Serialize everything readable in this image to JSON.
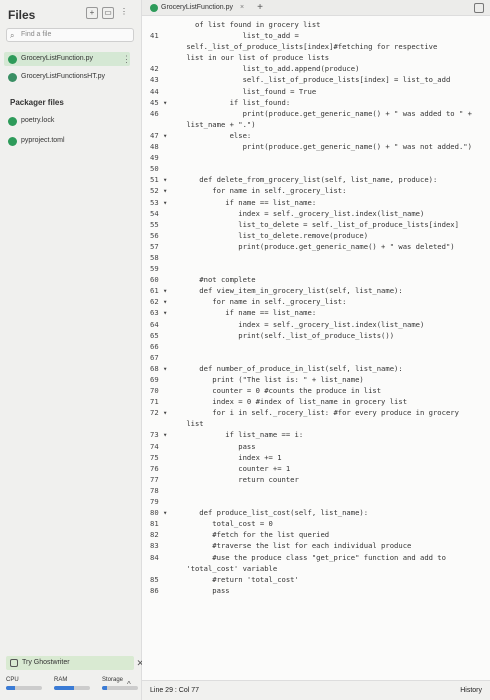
{
  "sidebar": {
    "title": "Files",
    "search_placeholder": "Find a file",
    "files": [
      {
        "name": "GroceryListFunction.py",
        "active": true
      },
      {
        "name": "GroceryListFunctionsHT.py",
        "active": false
      }
    ],
    "packages_label": "Packager files",
    "packages": [
      {
        "name": "poetry.lock"
      },
      {
        "name": "pyproject.toml"
      }
    ],
    "ghostwriter": "Try Ghostwriter",
    "meters": [
      {
        "label": "CPU",
        "level": 0.25
      },
      {
        "label": "RAM",
        "level": 0.55
      },
      {
        "label": "Storage",
        "level": 0.15
      }
    ]
  },
  "editor": {
    "tab_name": "GroceryListFunction.py",
    "tab_close": "×",
    "tab_plus": "+",
    "lines": [
      {
        "n": "",
        "t": "   of list found in grocery list"
      },
      {
        "n": "41",
        "t": "              list_to_add ="
      },
      {
        "n": "",
        "t": " self._list_of_produce_lists[index]#fetching for respective"
      },
      {
        "n": "",
        "t": " list in our list of produce lists"
      },
      {
        "n": "42",
        "t": "              list_to_add.append(produce)"
      },
      {
        "n": "43",
        "t": "              self._list_of_produce_lists[index] = list_to_add"
      },
      {
        "n": "44",
        "t": "              list_found = True"
      },
      {
        "n": "45 ▾",
        "t": "           if list_found:"
      },
      {
        "n": "46",
        "t": "              print(produce.get_generic_name() + \" was added to \" +"
      },
      {
        "n": "",
        "t": " list_name + \".\")"
      },
      {
        "n": "47 ▾",
        "t": "           else:"
      },
      {
        "n": "48",
        "t": "              print(produce.get_generic_name() + \" was not added.\")"
      },
      {
        "n": "49",
        "t": ""
      },
      {
        "n": "50",
        "t": ""
      },
      {
        "n": "51 ▾",
        "t": "    def delete_from_grocery_list(self, list_name, produce):"
      },
      {
        "n": "52 ▾",
        "t": "       for name in self._grocery_list:"
      },
      {
        "n": "53 ▾",
        "t": "          if name == list_name:"
      },
      {
        "n": "54",
        "t": "             index = self._grocery_list.index(list_name)"
      },
      {
        "n": "55",
        "t": "             list_to_delete = self._list_of_produce_lists[index]"
      },
      {
        "n": "56",
        "t": "             list_to_delete.remove(produce)"
      },
      {
        "n": "57",
        "t": "             print(produce.get_generic_name() + \" was deleted\")"
      },
      {
        "n": "58",
        "t": ""
      },
      {
        "n": "59",
        "t": ""
      },
      {
        "n": "60",
        "t": "    #not complete"
      },
      {
        "n": "61 ▾",
        "t": "    def view_item_in_grocery_list(self, list_name):"
      },
      {
        "n": "62 ▾",
        "t": "       for name in self._grocery_list:"
      },
      {
        "n": "63 ▾",
        "t": "          if name == list_name:"
      },
      {
        "n": "64",
        "t": "             index = self._grocery_list.index(list_name)"
      },
      {
        "n": "65",
        "t": "             print(self._list_of_produce_lists())"
      },
      {
        "n": "66",
        "t": ""
      },
      {
        "n": "67",
        "t": ""
      },
      {
        "n": "68 ▾",
        "t": "    def number_of_produce_in_list(self, list_name):"
      },
      {
        "n": "69",
        "t": "       print (\"The list is: \" + list_name)"
      },
      {
        "n": "70",
        "t": "       counter = 0 #counts the produce in list"
      },
      {
        "n": "71",
        "t": "       index = 0 #index of list_name in grocery list"
      },
      {
        "n": "72 ▾",
        "t": "       for i in self._rocery_list: #for every produce in grocery"
      },
      {
        "n": "",
        "t": " list"
      },
      {
        "n": "73 ▾",
        "t": "          if list_name == i:"
      },
      {
        "n": "74",
        "t": "             pass"
      },
      {
        "n": "75",
        "t": "             index += 1"
      },
      {
        "n": "76",
        "t": "             counter += 1"
      },
      {
        "n": "77",
        "t": "             return counter"
      },
      {
        "n": "78",
        "t": ""
      },
      {
        "n": "79",
        "t": ""
      },
      {
        "n": "80 ▾",
        "t": "    def produce_list_cost(self, list_name):"
      },
      {
        "n": "81",
        "t": "       total_cost = 0"
      },
      {
        "n": "82",
        "t": "       #fetch for the list queried"
      },
      {
        "n": "83",
        "t": "       #traverse the list for each individual produce"
      },
      {
        "n": "84",
        "t": "       #use the produce class \"get_price\" function and add to"
      },
      {
        "n": "",
        "t": " 'total_cost' variable"
      },
      {
        "n": "85",
        "t": "       #return 'total_cost'"
      },
      {
        "n": "86",
        "t": "       pass"
      }
    ]
  },
  "status": {
    "position": "Line 29 : Col 77",
    "history": "History"
  }
}
